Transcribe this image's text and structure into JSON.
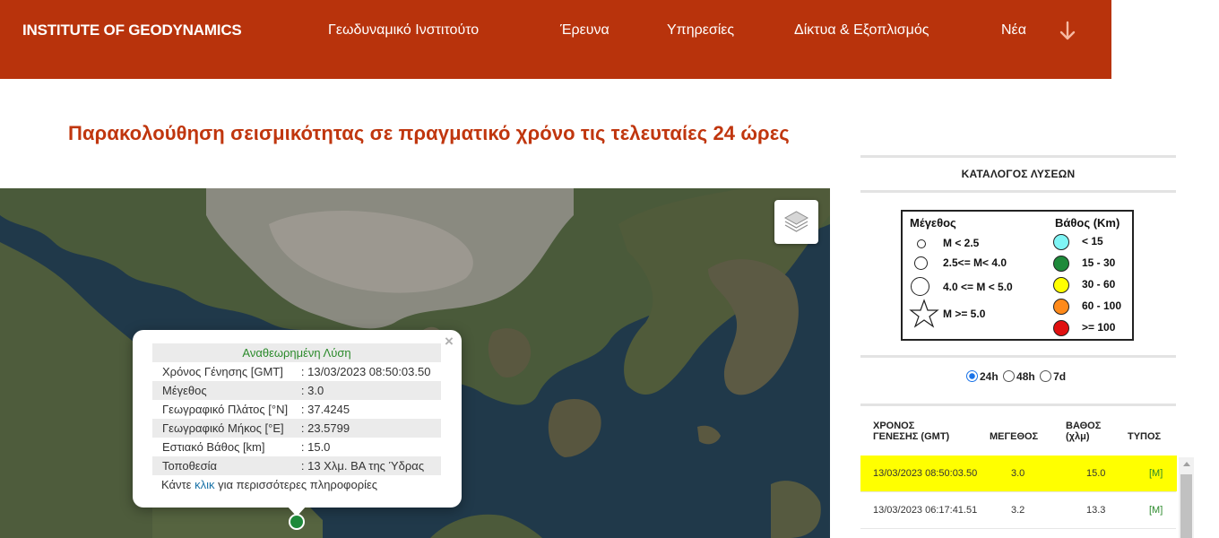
{
  "header": {
    "brand": "INSTITUTE OF GEODYNAMICS",
    "nav": [
      "Γεωδυναμικό Ινστιτούτο",
      "Έρευνα",
      "Υπηρεσίες",
      "Δίκτυα & Εξοπλισμός",
      "Νέα"
    ],
    "nav_more_icon": "arrow-down-icon",
    "bar_color": "#b8330c"
  },
  "page_title": "Παρακολούθηση σεισμικότητας σε πραγματικό χρόνο τις τελευταίες 24 ώρες",
  "map": {
    "layers_icon": "layers-icon",
    "popup": {
      "heading": "Αναθεωρημένη Λύση",
      "rows": [
        {
          "label": "Χρόνος Γένησης [GMT]",
          "value": ": 13/03/2023 08:50:03.50"
        },
        {
          "label": "Μέγεθος",
          "value": ": 3.0"
        },
        {
          "label": "Γεωγραφικό Πλάτος [°N]",
          "value": ": 37.4245"
        },
        {
          "label": "Γεωγραφικό Μήκος [°E]",
          "value": ": 23.5799"
        },
        {
          "label": "Εστιακό Βάθος [km]",
          "value": ": 15.0"
        },
        {
          "label": "Τοποθεσία",
          "value": ": 13 Χλμ. ΒΑ της Ύδρας"
        }
      ],
      "more_prefix": "Κάντε ",
      "more_link": "κλικ",
      "more_suffix": " για περισσότερες πληροφορίες",
      "close": "×"
    },
    "marker_color": "#1e8a3a"
  },
  "panel": {
    "catalog_title": "ΚΑΤΑΛΟΓΟΣ ΛΥΣΕΩΝ",
    "legend": {
      "magnitude_heading": "Μέγεθος",
      "magnitude_items": [
        "M < 2.5",
        "2.5<= M< 4.0",
        "4.0 <= M < 5.0",
        "M >= 5.0"
      ],
      "depth_heading": "Βάθος (Km)",
      "depth_items": [
        {
          "label": "< 15",
          "color": "#7ff5f5"
        },
        {
          "label": "15 - 30",
          "color": "#1e8a3a"
        },
        {
          "label": "30 - 60",
          "color": "#ffff00"
        },
        {
          "label": "60 - 100",
          "color": "#ff8a1a"
        },
        {
          "label": ">= 100",
          "color": "#e01010"
        }
      ]
    },
    "time_options": [
      "24h",
      "48h",
      "7d"
    ],
    "time_selected": "24h",
    "columns": {
      "time": [
        "ΧΡΟΝΟΣ",
        "ΓΕΝΕΣΗΣ (GMT)"
      ],
      "magnitude": "ΜΕΓΕΘΟΣ",
      "depth": [
        "ΒΑΘΟΣ",
        "(χλμ)"
      ],
      "type": "ΤΥΠΟΣ"
    },
    "rows": [
      {
        "time": "13/03/2023 08:50:03.50",
        "magnitude": "3.0",
        "depth": "15.0",
        "type": "[M]",
        "highlighted": true
      },
      {
        "time": "13/03/2023 06:17:41.51",
        "magnitude": "3.2",
        "depth": "13.3",
        "type": "[M]",
        "highlighted": false
      }
    ]
  }
}
